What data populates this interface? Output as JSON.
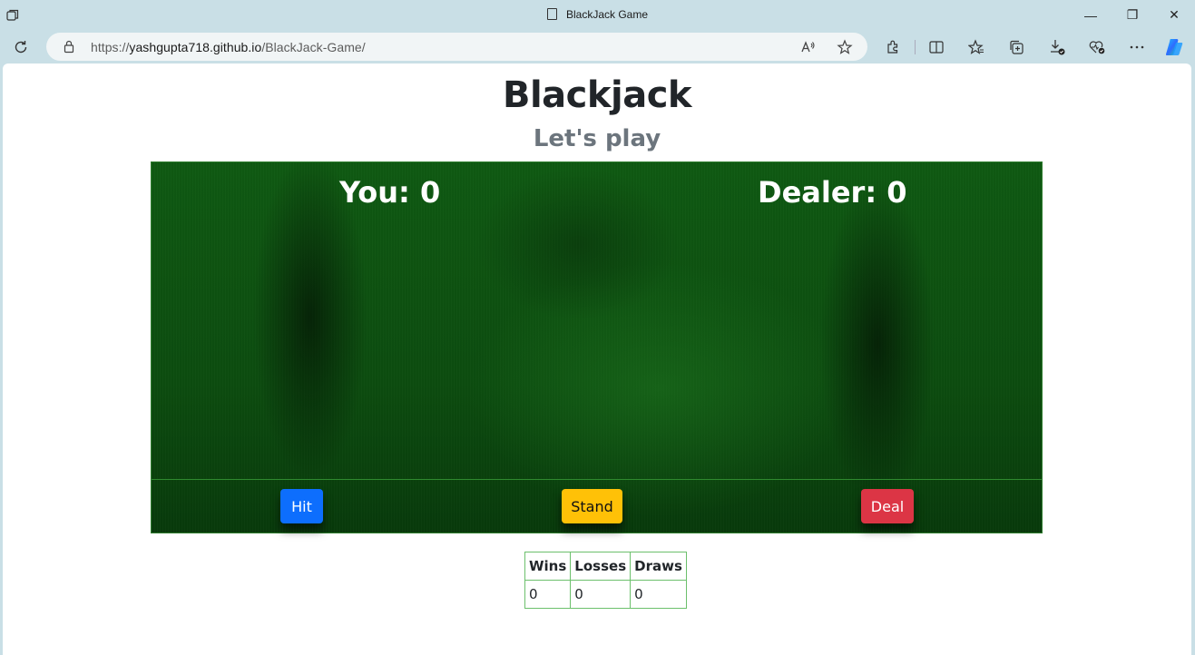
{
  "browser": {
    "tab_title": "BlackJack Game",
    "url_scheme": "https://",
    "url_host": "yashgupta718.github.io",
    "url_path": "/BlackJack-Game/",
    "minimize_glyph": "—",
    "restore_glyph": "❐",
    "close_glyph": "✕",
    "icons": [
      "tab-actions-icon",
      "document-icon",
      "reload-icon",
      "lock-icon",
      "read-aloud-icon",
      "favorite-star-icon",
      "extensions-icon",
      "split-screen-icon",
      "favorites-icon",
      "collections-icon",
      "downloads-icon",
      "browser-essentials-icon",
      "more-menu-icon",
      "copilot-icon"
    ]
  },
  "page": {
    "title": "Blackjack",
    "subtitle": "Let's play",
    "you_score": "You: 0",
    "dealer_score": "Dealer: 0",
    "buttons": {
      "hit": "Hit",
      "stand": "Stand",
      "deal": "Deal"
    },
    "stats": {
      "headers": [
        "Wins",
        "Losses",
        "Draws"
      ],
      "values": [
        "0",
        "0",
        "0"
      ]
    }
  },
  "colors": {
    "hit": "#0d6efd",
    "stand": "#ffc107",
    "deal": "#dc3545",
    "felt": "#0c4c0f"
  }
}
